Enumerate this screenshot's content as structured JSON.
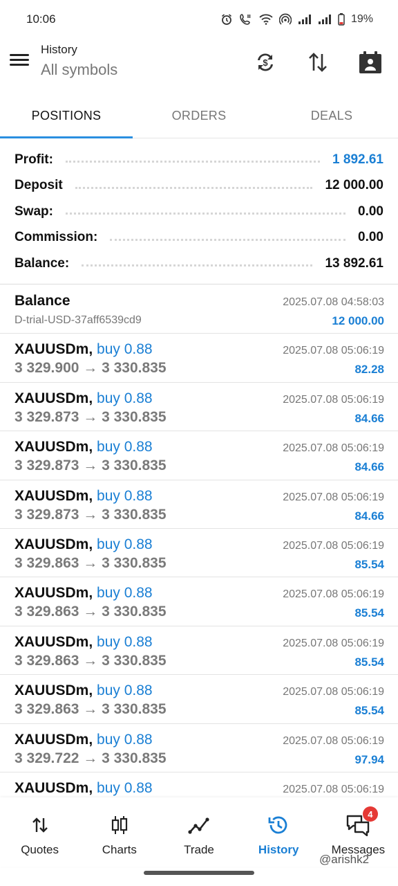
{
  "status_bar": {
    "time": "10:06",
    "battery": "19%",
    "icons": [
      "alarm-icon",
      "call-icon",
      "wifi-icon",
      "hotspot-icon",
      "signal-icon",
      "signal-icon",
      "battery-icon"
    ]
  },
  "header": {
    "title": "History",
    "subtitle": "All symbols",
    "actions": [
      "sync-currency-icon",
      "sort-icon",
      "calendar-icon"
    ]
  },
  "tabs": [
    {
      "label": "POSITIONS",
      "active": true
    },
    {
      "label": "ORDERS",
      "active": false
    },
    {
      "label": "DEALS",
      "active": false
    }
  ],
  "summary": [
    {
      "label": "Profit:",
      "value": "1 892.61",
      "highlight": true
    },
    {
      "label": "Deposit",
      "value": "12 000.00",
      "highlight": false
    },
    {
      "label": "Swap:",
      "value": "0.00",
      "highlight": false
    },
    {
      "label": "Commission:",
      "value": "0.00",
      "highlight": false
    },
    {
      "label": "Balance:",
      "value": "13 892.61",
      "highlight": false
    }
  ],
  "balance_entry": {
    "title": "Balance",
    "subtitle": "D-trial-USD-37aff6539cd9",
    "time": "2025.07.08 04:58:03",
    "amount": "12 000.00"
  },
  "positions": [
    {
      "symbol": "XAUUSDm,",
      "direction": "buy 0.88",
      "prices": "3 329.900 → 3 330.835",
      "time": "2025.07.08 05:06:19",
      "profit": "82.28"
    },
    {
      "symbol": "XAUUSDm,",
      "direction": "buy 0.88",
      "prices": "3 329.873 → 3 330.835",
      "time": "2025.07.08 05:06:19",
      "profit": "84.66"
    },
    {
      "symbol": "XAUUSDm,",
      "direction": "buy 0.88",
      "prices": "3 329.873 → 3 330.835",
      "time": "2025.07.08 05:06:19",
      "profit": "84.66"
    },
    {
      "symbol": "XAUUSDm,",
      "direction": "buy 0.88",
      "prices": "3 329.873 → 3 330.835",
      "time": "2025.07.08 05:06:19",
      "profit": "84.66"
    },
    {
      "symbol": "XAUUSDm,",
      "direction": "buy 0.88",
      "prices": "3 329.863 → 3 330.835",
      "time": "2025.07.08 05:06:19",
      "profit": "85.54"
    },
    {
      "symbol": "XAUUSDm,",
      "direction": "buy 0.88",
      "prices": "3 329.863 → 3 330.835",
      "time": "2025.07.08 05:06:19",
      "profit": "85.54"
    },
    {
      "symbol": "XAUUSDm,",
      "direction": "buy 0.88",
      "prices": "3 329.863 → 3 330.835",
      "time": "2025.07.08 05:06:19",
      "profit": "85.54"
    },
    {
      "symbol": "XAUUSDm,",
      "direction": "buy 0.88",
      "prices": "3 329.863 → 3 330.835",
      "time": "2025.07.08 05:06:19",
      "profit": "85.54"
    },
    {
      "symbol": "XAUUSDm,",
      "direction": "buy 0.88",
      "prices": "3 329.722 → 3 330.835",
      "time": "2025.07.08 05:06:19",
      "profit": "97.94"
    },
    {
      "symbol": "XAUUSDm,",
      "direction": "buy 0.88",
      "prices": "",
      "time": "2025.07.08 05:06:19",
      "profit": ""
    }
  ],
  "bottom_nav": [
    {
      "label": "Quotes",
      "icon": "quotes-icon",
      "active": false
    },
    {
      "label": "Charts",
      "icon": "candlestick-icon",
      "active": false
    },
    {
      "label": "Trade",
      "icon": "trend-line-icon",
      "active": false
    },
    {
      "label": "History",
      "icon": "history-icon",
      "active": true
    },
    {
      "label": "Messages",
      "icon": "messages-icon",
      "active": false,
      "badge": "4"
    }
  ],
  "watermark": "@arishk2",
  "colors": {
    "accent": "#1a7fd4",
    "badge": "#e53935"
  }
}
